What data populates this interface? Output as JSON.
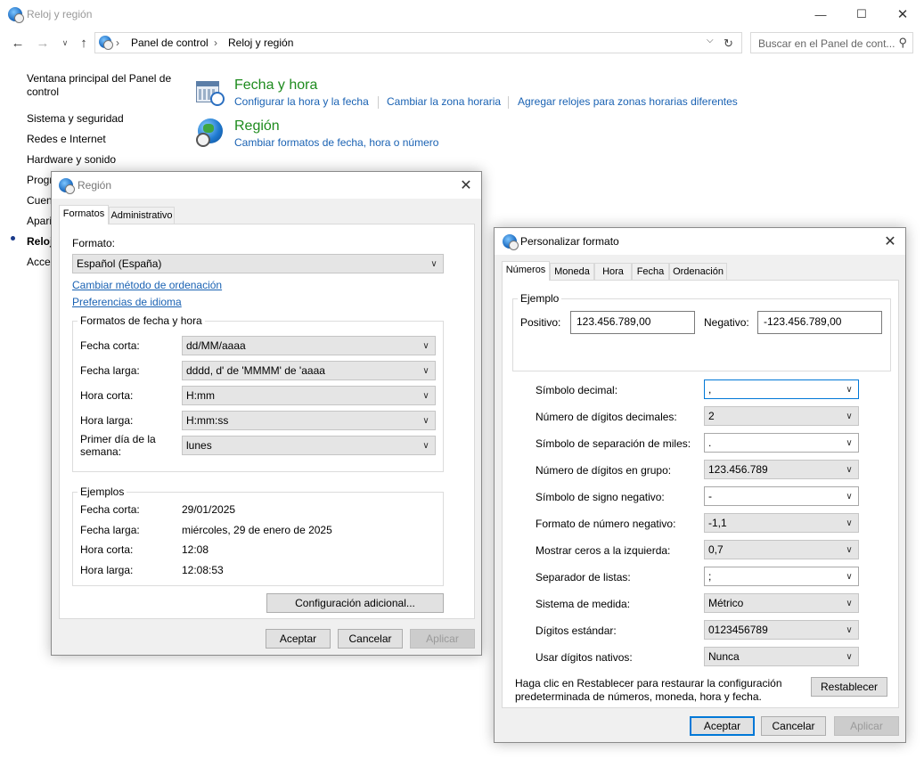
{
  "window": {
    "title": "Reloj y región",
    "controls": [
      "minimize-icon",
      "maximize-icon",
      "close-icon"
    ]
  },
  "address": {
    "crumbs": [
      "Panel de control",
      "Reloj y región"
    ],
    "search_placeholder": "Buscar en el Panel de cont..."
  },
  "sidebar": {
    "items": [
      {
        "label": "Ventana principal del Panel de control"
      },
      {
        "label": "Sistema y seguridad"
      },
      {
        "label": "Redes e Internet"
      },
      {
        "label": "Hardware y sonido"
      },
      {
        "label": "Progr"
      },
      {
        "label": "Cuen"
      },
      {
        "label": "Apari"
      },
      {
        "label": "Reloj",
        "active": true
      },
      {
        "label": "Acces"
      }
    ]
  },
  "categories": [
    {
      "title": "Fecha y hora",
      "links": [
        "Configurar la hora y la fecha",
        "Cambiar la zona horaria",
        "Agregar relojes para zonas horarias diferentes"
      ]
    },
    {
      "title": "Región",
      "links": [
        "Cambiar formatos de fecha, hora o número"
      ]
    }
  ],
  "region_dialog": {
    "title": "Región",
    "tabs": [
      "Formatos",
      "Administrativo"
    ],
    "format_label": "Formato:",
    "format_value": "Español (España)",
    "link_sort": "Cambiar método de ordenación",
    "link_lang": "Preferencias de idioma",
    "group_formats": "Formatos de fecha y hora",
    "fields": [
      {
        "label": "Fecha corta:",
        "value": "dd/MM/aaaa"
      },
      {
        "label": "Fecha larga:",
        "value": "dddd, d' de 'MMMM' de 'aaaa"
      },
      {
        "label": "Hora corta:",
        "value": "H:mm"
      },
      {
        "label": "Hora larga:",
        "value": "H:mm:ss"
      },
      {
        "label": "Primer día de la semana:",
        "value": "lunes"
      }
    ],
    "group_examples": "Ejemplos",
    "examples": [
      {
        "label": "Fecha corta:",
        "value": "29/01/2025"
      },
      {
        "label": "Fecha larga:",
        "value": "miércoles, 29 de enero de 2025"
      },
      {
        "label": "Hora corta:",
        "value": "12:08"
      },
      {
        "label": "Hora larga:",
        "value": "12:08:53"
      }
    ],
    "additional_button": "Configuración adicional...",
    "ok": "Aceptar",
    "cancel": "Cancelar",
    "apply": "Aplicar"
  },
  "custom_dialog": {
    "title": "Personalizar formato",
    "tabs": [
      "Números",
      "Moneda",
      "Hora",
      "Fecha",
      "Ordenación"
    ],
    "example_group": "Ejemplo",
    "positive_label": "Positivo:",
    "positive_value": "123.456.789,00",
    "negative_label": "Negativo:",
    "negative_value": "-123.456.789,00",
    "settings": [
      {
        "label": "Símbolo decimal:",
        "value": ","
      },
      {
        "label": "Número de dígitos decimales:",
        "value": "2"
      },
      {
        "label": "Símbolo de separación de miles:",
        "value": "."
      },
      {
        "label": "Número de dígitos en grupo:",
        "value": "123.456.789"
      },
      {
        "label": "Símbolo de signo negativo:",
        "value": "-"
      },
      {
        "label": "Formato de número negativo:",
        "value": "-1,1"
      },
      {
        "label": "Mostrar ceros a la izquierda:",
        "value": "0,7"
      },
      {
        "label": "Separador de listas:",
        "value": ";"
      },
      {
        "label": "Sistema de medida:",
        "value": "Métrico"
      },
      {
        "label": "Dígitos estándar:",
        "value": "0123456789"
      },
      {
        "label": "Usar dígitos nativos:",
        "value": "Nunca"
      }
    ],
    "reset_text_1": "Haga clic en Restablecer para restaurar la configuración",
    "reset_text_2": "predeterminada de números, moneda, hora y fecha.",
    "reset_button": "Restablecer",
    "ok": "Aceptar",
    "cancel": "Cancelar",
    "apply": "Aplicar"
  }
}
